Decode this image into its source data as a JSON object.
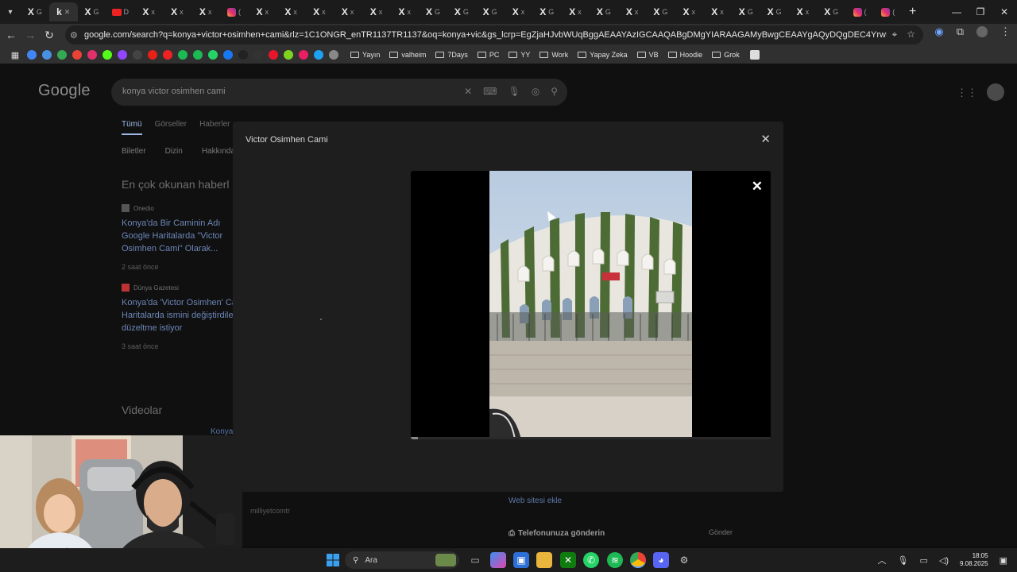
{
  "browser": {
    "tabs": [
      {
        "icon": "x-logo-icon",
        "glyph": "X",
        "letter": "G"
      },
      {
        "icon": "kick-icon",
        "glyph": "k",
        "letter": "✕",
        "active": true
      },
      {
        "icon": "x-logo-icon",
        "glyph": "X",
        "letter": "G"
      },
      {
        "icon": "youtube-icon",
        "glyph": "",
        "letter": "D"
      },
      {
        "icon": "x-logo-icon",
        "glyph": "X",
        "letter": "x"
      },
      {
        "icon": "x-logo-icon",
        "glyph": "X",
        "letter": "x"
      },
      {
        "icon": "x-logo-icon",
        "glyph": "X",
        "letter": "x"
      },
      {
        "icon": "instagram-icon",
        "glyph": "",
        "letter": "("
      },
      {
        "icon": "x-logo-icon",
        "glyph": "X",
        "letter": "x"
      },
      {
        "icon": "x-logo-icon",
        "glyph": "X",
        "letter": "x"
      },
      {
        "icon": "x-logo-icon",
        "glyph": "X",
        "letter": "x"
      },
      {
        "icon": "x-logo-icon",
        "glyph": "X",
        "letter": "x"
      },
      {
        "icon": "x-logo-icon",
        "glyph": "X",
        "letter": "x"
      },
      {
        "icon": "x-logo-icon",
        "glyph": "X",
        "letter": "x"
      },
      {
        "icon": "x-logo-icon",
        "glyph": "X",
        "letter": "G"
      },
      {
        "icon": "x-logo-icon",
        "glyph": "X",
        "letter": "G"
      },
      {
        "icon": "x-logo-icon",
        "glyph": "X",
        "letter": "G"
      },
      {
        "icon": "x-logo-icon",
        "glyph": "X",
        "letter": "x"
      },
      {
        "icon": "x-logo-icon",
        "glyph": "X",
        "letter": "G"
      },
      {
        "icon": "x-logo-icon",
        "glyph": "X",
        "letter": "x"
      },
      {
        "icon": "x-logo-icon",
        "glyph": "X",
        "letter": "G"
      },
      {
        "icon": "x-logo-icon",
        "glyph": "X",
        "letter": "x"
      },
      {
        "icon": "x-logo-icon",
        "glyph": "X",
        "letter": "G"
      },
      {
        "icon": "x-logo-icon",
        "glyph": "X",
        "letter": "x"
      },
      {
        "icon": "x-logo-icon",
        "glyph": "X",
        "letter": "x"
      },
      {
        "icon": "x-logo-icon",
        "glyph": "X",
        "letter": "G"
      },
      {
        "icon": "x-logo-icon",
        "glyph": "X",
        "letter": "G"
      },
      {
        "icon": "x-logo-icon",
        "glyph": "X",
        "letter": "x"
      },
      {
        "icon": "x-logo-icon",
        "glyph": "X",
        "letter": "G"
      },
      {
        "icon": "instagram-icon",
        "glyph": "",
        "letter": "("
      },
      {
        "icon": "instagram-icon",
        "glyph": "",
        "letter": "("
      }
    ],
    "new_tab": "+",
    "url": "google.com/search?q=konya+victor+osimhen+cami&rlz=1C1ONGR_enTR1137TR1137&oq=konya+vic&gs_lcrp=EgZjaHJvbWUqBggAEAAYAzIGCAAQABgDMgYIARAAGAMyBwgCEAAYgAQyDQgDEC4YrwEYxwEYgAQyBggEEEUYOTIICAUQABgWG...",
    "bookmark_folders": [
      "Yayın",
      "valheim",
      "7Days",
      "PC",
      "YY",
      "Work",
      "Yapay Zeka",
      "VB",
      "Hoodie",
      "Grok"
    ],
    "bookmark_colors": [
      "#4285f4",
      "#4a90e2",
      "#34a853",
      "#ea4335",
      "#e1306c",
      "#53fc18",
      "#9146ff",
      "#444",
      "#e62117",
      "#e22",
      "#1db954",
      "#1db954",
      "#25d366",
      "#1877f2",
      "#222",
      "#333",
      "#e6162d",
      "#7ed321",
      "#e91e63",
      "#1da1f2",
      "#888"
    ]
  },
  "google": {
    "logo": "Google",
    "query": "konya victor osimhen cami",
    "filter_tabs": [
      "Tümü",
      "Görseller",
      "Haberler"
    ],
    "chips": [
      "Biletler",
      "Dizin",
      "Hakkında"
    ],
    "top_stories": "En çok okunan haberl",
    "news": [
      {
        "source": "Onedio",
        "title": "Konya'da Bir Caminin Adı Google Haritalarda \"Victor Osimhen Cami\" Olarak...",
        "time": "2 saat önce"
      },
      {
        "source": "Dünya Gazetesi",
        "title": "Konya'da 'Victor Osimhen' Ca Haritalarda ismini değiştirdiler düzeltme istiyor",
        "time": "3 saat önce"
      }
    ],
    "videos": "Videolar",
    "videos_peek": "Konya",
    "behind_lines": [
      "milliyetcomtr",
      "Web sitesi ekle",
      "Telefonunuza gönderin",
      "Gönder"
    ]
  },
  "modal": {
    "title": "Victor Osimhen Cami",
    "progress": 0.02
  },
  "taskbar": {
    "search_label": "Ara",
    "time": "18:05",
    "date": "9.08.2025"
  }
}
